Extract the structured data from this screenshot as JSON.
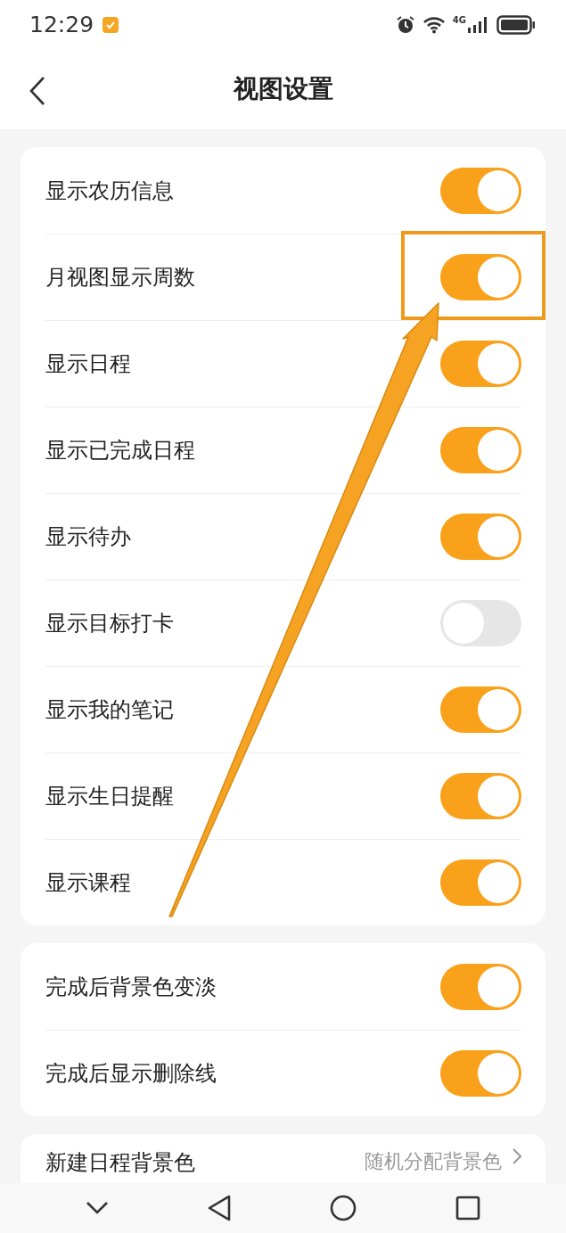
{
  "status_bar": {
    "time": "12:29",
    "network": "4G"
  },
  "header": {
    "title": "视图设置"
  },
  "groups": [
    {
      "items": [
        {
          "label": "显示农历信息",
          "on": true
        },
        {
          "label": "月视图显示周数",
          "on": true
        },
        {
          "label": "显示日程",
          "on": true
        },
        {
          "label": "显示已完成日程",
          "on": true
        },
        {
          "label": "显示待办",
          "on": true
        },
        {
          "label": "显示目标打卡",
          "on": false
        },
        {
          "label": "显示我的笔记",
          "on": true
        },
        {
          "label": "显示生日提醒",
          "on": true
        },
        {
          "label": "显示课程",
          "on": true
        }
      ]
    },
    {
      "items": [
        {
          "label": "完成后背景色变淡",
          "on": true
        },
        {
          "label": "完成后显示删除线",
          "on": true
        }
      ]
    },
    {
      "items": [
        {
          "label": "新建日程背景色",
          "kind": "value",
          "value": "随机分配背景色"
        }
      ]
    }
  ],
  "annotations": [
    {
      "kind": "box"
    },
    {
      "kind": "arrow"
    }
  ]
}
